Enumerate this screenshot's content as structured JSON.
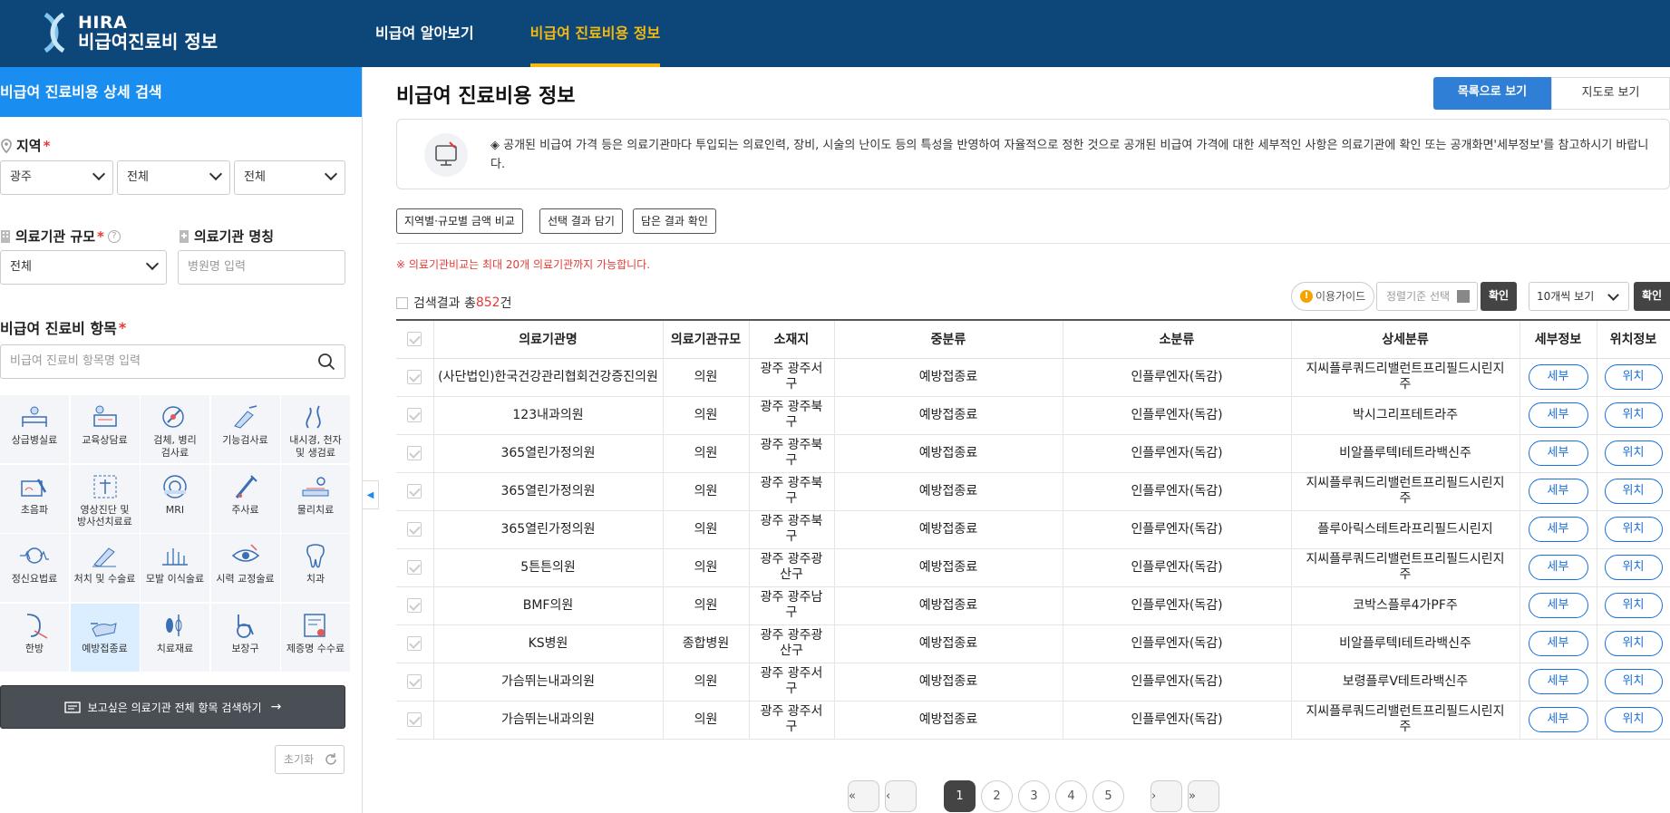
{
  "header": {
    "logo_line1": "HIRA",
    "logo_line2": "비급여진료비 정보",
    "nav": [
      "비급여 알아보기",
      "비급여 진료비용 정보"
    ]
  },
  "sidebar": {
    "title": "비급여 진료비용 상세 검색",
    "region_label": "지역",
    "region_selects": [
      "광주",
      "전체",
      "전체"
    ],
    "scale_label": "의료기관 규모",
    "scale_value": "전체",
    "name_label": "의료기관 명칭",
    "name_placeholder": "병원명 입력",
    "item_label": "비급여 진료비 항목",
    "item_placeholder": "비급여 진료비 항목명 입력",
    "categories": [
      {
        "label": "상급병실료",
        "icon": "bed-icon"
      },
      {
        "label": "교육상담료",
        "icon": "counseling-icon"
      },
      {
        "label": "검체, 병리\n검사료",
        "icon": "specimen-icon"
      },
      {
        "label": "기능검사료",
        "icon": "function-test-icon"
      },
      {
        "label": "내시경, 천자\n및 생검료",
        "icon": "endoscope-icon"
      },
      {
        "label": "초음파",
        "icon": "ultrasound-icon"
      },
      {
        "label": "영상진단 및\n방사선치료료",
        "icon": "imaging-icon"
      },
      {
        "label": "MRI",
        "icon": "mri-icon"
      },
      {
        "label": "주사료",
        "icon": "syringe-icon"
      },
      {
        "label": "물리치료",
        "icon": "physical-therapy-icon"
      },
      {
        "label": "정신요법료",
        "icon": "brain-wave-icon"
      },
      {
        "label": "처치 및 수술료",
        "icon": "surgery-icon"
      },
      {
        "label": "모발 이식술료",
        "icon": "hair-transplant-icon"
      },
      {
        "label": "시력 교정술료",
        "icon": "eye-icon"
      },
      {
        "label": "치과",
        "icon": "tooth-icon"
      },
      {
        "label": "한방",
        "icon": "acupuncture-icon"
      },
      {
        "label": "예방접종료",
        "icon": "vaccine-icon"
      },
      {
        "label": "치료재료",
        "icon": "material-icon"
      },
      {
        "label": "보장구",
        "icon": "wheelchair-icon"
      },
      {
        "label": "제증명 수수료",
        "icon": "certificate-icon"
      }
    ],
    "active_category": 16,
    "search_all": "보고싶은 의료기관 전체 항목 검색하기",
    "reset": "초기화"
  },
  "main": {
    "title": "비급여 진료비용 정보",
    "view_list": "목록으로 보기",
    "view_map": "지도로 보기",
    "notice": "◈ 공개된 비급여 가격 등은 의료기관마다 투입되는 의료인력, 장비, 시술의 난이도 등의 특성을 반영하여 자율적으로 정한 것으로 공개된 비급여 가격에 대한 세부적인 사항은 의료기관에 확인 또는 공개화면'세부정보'를 참고하시기 바랍니다.",
    "actions": [
      "지역별·규모별 금액 비교",
      "선택 결과 담기",
      "담은 결과 확인"
    ],
    "warning": "※ 의료기관비교는 최대 20개 의료기관까지 가능합니다.",
    "result_prefix": "검색결과 총",
    "result_count": "852",
    "result_suffix": "건",
    "guide": "이용가이드",
    "sort_placeholder": "정렬기준 선택",
    "confirm": "확인",
    "page_size": "10개씩 보기",
    "columns": [
      "의료기관명",
      "의료기관규모",
      "소재지",
      "중분류",
      "소분류",
      "상세분류",
      "세부정보",
      "위치정보"
    ],
    "rows": [
      [
        "(사단법인)한국건강관리협회건강증진의원",
        "의원",
        "광주 광주서구",
        "예방접종료",
        "인플루엔자(독감)",
        "지씨플루쿼드리밸런트프리필드시린지주"
      ],
      [
        "123내과의원",
        "의원",
        "광주 광주북구",
        "예방접종료",
        "인플루엔자(독감)",
        "박시그리프테트라주"
      ],
      [
        "365열린가정의원",
        "의원",
        "광주 광주북구",
        "예방접종료",
        "인플루엔자(독감)",
        "비알플루텍I테트라백신주"
      ],
      [
        "365열린가정의원",
        "의원",
        "광주 광주북구",
        "예방접종료",
        "인플루엔자(독감)",
        "지씨플루쿼드리밸런트프리필드시린지주"
      ],
      [
        "365열린가정의원",
        "의원",
        "광주 광주북구",
        "예방접종료",
        "인플루엔자(독감)",
        "플루아릭스테트라프리필드시린지"
      ],
      [
        "5튼튼의원",
        "의원",
        "광주 광주광산구",
        "예방접종료",
        "인플루엔자(독감)",
        "지씨플루쿼드리밸런트프리필드시린지주"
      ],
      [
        "BMF의원",
        "의원",
        "광주 광주남구",
        "예방접종료",
        "인플루엔자(독감)",
        "코박스플루4가PF주"
      ],
      [
        "KS병원",
        "종합병원",
        "광주 광주광산구",
        "예방접종료",
        "인플루엔자(독감)",
        "비알플루텍I테트라백신주"
      ],
      [
        "가슴뛰는내과의원",
        "의원",
        "광주 광주서구",
        "예방접종료",
        "인플루엔자(독감)",
        "보령플루Ⅴ테트라백신주"
      ],
      [
        "가슴뛰는내과의원",
        "의원",
        "광주 광주서구",
        "예방접종료",
        "인플루엔자(독감)",
        "지씨플루쿼드리밸런트프리필드시린지주"
      ]
    ],
    "detail_btn": "세부",
    "location_btn": "위치",
    "pages": [
      "1",
      "2",
      "3",
      "4",
      "5"
    ],
    "current_page": "1"
  },
  "colors": {
    "header_bg": "#0d4679",
    "nav_active": "#f5b90f",
    "sidebar_title_bg": "#1a8ef0",
    "view_list_bg": "#2f7fd6",
    "required": "#e53935"
  }
}
